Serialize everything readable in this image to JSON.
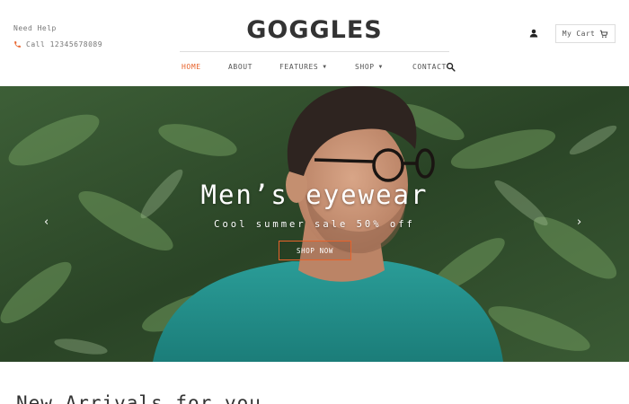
{
  "header": {
    "help_text": "Need Help",
    "call_text": "Call 12345678089",
    "logo": "GOGGLES",
    "cart_label": "My Cart",
    "icons": {
      "phone": "phone-icon",
      "user": "user-icon",
      "cart": "cart-icon",
      "search": "search-icon"
    }
  },
  "nav": {
    "items": [
      {
        "label": "HOME",
        "active": true
      },
      {
        "label": "ABOUT"
      },
      {
        "label": "FEATURES",
        "dropdown": true
      },
      {
        "label": "SHOP",
        "dropdown": true
      },
      {
        "label": "CONTACT"
      }
    ]
  },
  "hero": {
    "title": "Men’s eyewear",
    "subtitle": "Cool summer sale 50% off",
    "button_label": "SHOP NOW",
    "prev_icon": "chevron-left-icon",
    "next_icon": "chevron-right-icon"
  },
  "section": {
    "title": "New Arrivals for you"
  },
  "colors": {
    "accent": "#e8632b",
    "text": "#333333",
    "foliage": "#2f4a2a",
    "shirt": "#1f8c88"
  }
}
